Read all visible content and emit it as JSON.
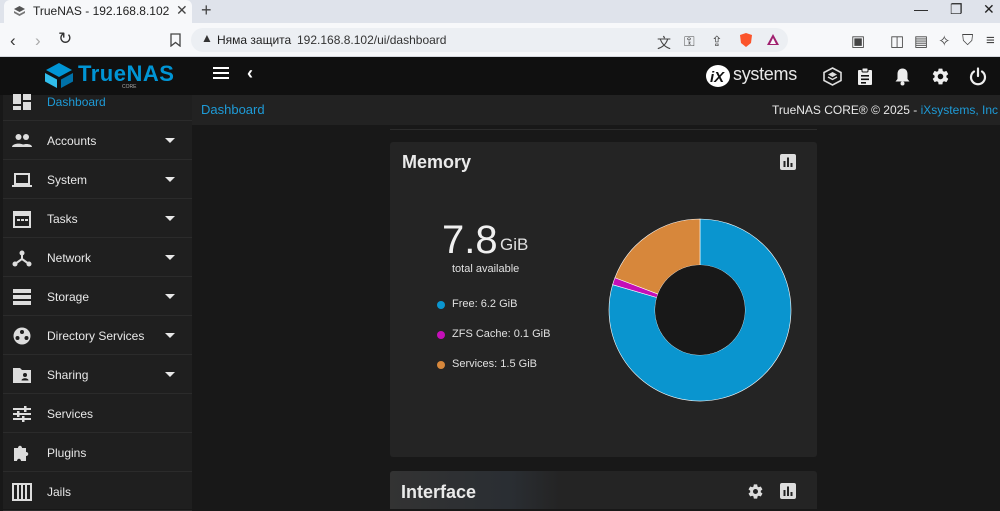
{
  "browser": {
    "tab_title": "TrueNAS - 192.168.8.102",
    "not_secure_label": "Няма защита",
    "url": "192.168.8.102/ui/dashboard"
  },
  "header": {
    "logo_text": "TrueNAS",
    "logo_sub": "CORE",
    "vendor_logo_text": "systems"
  },
  "breadcrumb": {
    "current": "Dashboard",
    "copyright": "TrueNAS CORE® © 2025 - ",
    "copyright_link": "iXsystems, Inc"
  },
  "sidebar": {
    "items": [
      {
        "label": "Dashboard",
        "icon": "dashboard-icon",
        "expandable": false,
        "active": true
      },
      {
        "label": "Accounts",
        "icon": "people-icon",
        "expandable": true
      },
      {
        "label": "System",
        "icon": "laptop-icon",
        "expandable": true
      },
      {
        "label": "Tasks",
        "icon": "calendar-icon",
        "expandable": true
      },
      {
        "label": "Network",
        "icon": "network-icon",
        "expandable": true
      },
      {
        "label": "Storage",
        "icon": "storage-icon",
        "expandable": true
      },
      {
        "label": "Directory Services",
        "icon": "directory-icon",
        "expandable": true
      },
      {
        "label": "Sharing",
        "icon": "folder-shared-icon",
        "expandable": true
      },
      {
        "label": "Services",
        "icon": "tune-icon",
        "expandable": false
      },
      {
        "label": "Plugins",
        "icon": "puzzle-icon",
        "expandable": false
      },
      {
        "label": "Jails",
        "icon": "jail-icon",
        "expandable": false
      }
    ]
  },
  "memory_card": {
    "title": "Memory",
    "total_value": "7.8",
    "total_unit": "GiB",
    "total_label": "total available",
    "legend": [
      {
        "label": "Free: 6.2 GiB",
        "color": "#0a95cf"
      },
      {
        "label": "ZFS Cache: 0.1 GiB",
        "color": "#c40fb8"
      },
      {
        "label": "Services: 1.5 GiB",
        "color": "#d7873b"
      }
    ],
    "chart_data": {
      "type": "pie",
      "categories": [
        "Free",
        "ZFS Cache",
        "Services"
      ],
      "values": [
        6.2,
        0.1,
        1.5
      ],
      "colors": [
        "#0a95cf",
        "#c40fb8",
        "#d7873b"
      ]
    }
  },
  "interface_card": {
    "title": "Interface"
  },
  "colors": {
    "accent": "#1e9bd7",
    "header_bg": "#101010",
    "sidebar_bg": "#1f1f1f",
    "card_bg": "#242424"
  }
}
